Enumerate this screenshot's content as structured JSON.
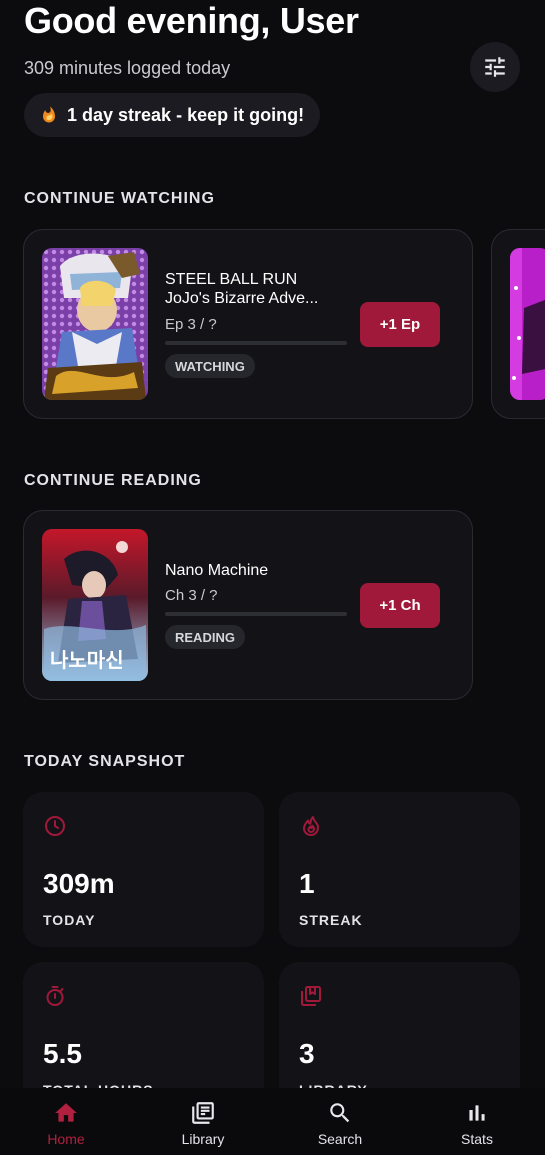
{
  "header": {
    "greeting": "Good evening, User",
    "subline": "309 minutes logged today",
    "streak_text": "1 day streak - keep it going!"
  },
  "sections": {
    "continue_watching": "CONTINUE WATCHING",
    "continue_reading": "CONTINUE READING",
    "today_snapshot": "TODAY SNAPSHOT"
  },
  "watching": {
    "title_line1": "STEEL BALL RUN",
    "title_line2": "JoJo's Bizarre Adve...",
    "progress_text": "Ep 3 / ?",
    "status": "WATCHING",
    "action_label": "+1 Ep"
  },
  "reading": {
    "title": "Nano Machine",
    "progress_text": "Ch 3 / ?",
    "status": "READING",
    "action_label": "+1 Ch"
  },
  "stats": [
    {
      "value": "309m",
      "label": "TODAY",
      "icon": "clock-icon"
    },
    {
      "value": "1",
      "label": "STREAK",
      "icon": "flame-icon"
    },
    {
      "value": "5.5",
      "label": "TOTAL HOURS",
      "icon": "timer-icon"
    },
    {
      "value": "3",
      "label": "LIBRARY",
      "icon": "library-stack-icon"
    }
  ],
  "nav": [
    {
      "label": "Home",
      "icon": "home-icon",
      "active": true
    },
    {
      "label": "Library",
      "icon": "library-icon",
      "active": false
    },
    {
      "label": "Search",
      "icon": "search-icon",
      "active": false
    },
    {
      "label": "Stats",
      "icon": "bar-chart-icon",
      "active": false
    }
  ],
  "colors": {
    "accent": "#a0183a",
    "background": "#0c0c0f",
    "card": "#131317"
  }
}
